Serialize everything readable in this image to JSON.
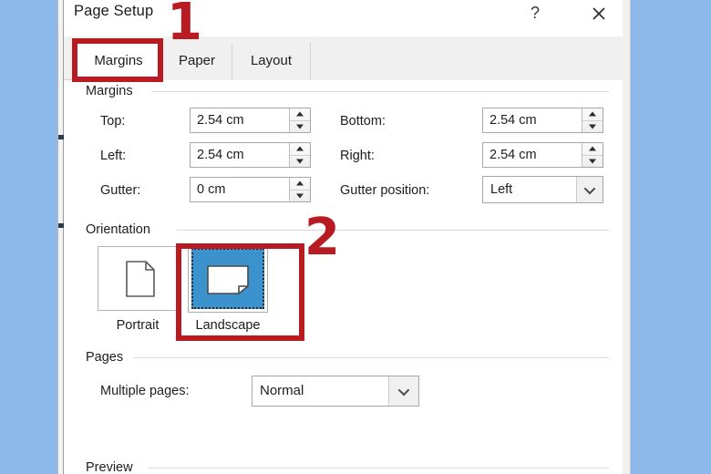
{
  "window": {
    "title": "Page Setup",
    "help_icon": "?",
    "help_icon_name": "help-icon",
    "close_icon_name": "close-icon"
  },
  "tabs": [
    {
      "label": "Margins",
      "active": true
    },
    {
      "label": "Paper",
      "active": false
    },
    {
      "label": "Layout",
      "active": false
    }
  ],
  "groups": {
    "margins": {
      "title": "Margins"
    },
    "orientation": {
      "title": "Orientation"
    },
    "pages": {
      "title": "Pages"
    },
    "preview": {
      "title": "Preview"
    }
  },
  "margins": {
    "top": {
      "label": "Top:",
      "value": "2.54 cm"
    },
    "left": {
      "label": "Left:",
      "value": "2.54 cm"
    },
    "gutter": {
      "label": "Gutter:",
      "value": "0 cm"
    },
    "bottom": {
      "label": "Bottom:",
      "value": "2.54 cm"
    },
    "right": {
      "label": "Right:",
      "value": "2.54 cm"
    },
    "gutter_position": {
      "label": "Gutter position:",
      "value": "Left"
    }
  },
  "orientation": {
    "portrait": {
      "label": "Portrait",
      "selected": false
    },
    "landscape": {
      "label": "Landscape",
      "selected": true
    }
  },
  "pages": {
    "multiple_pages": {
      "label": "Multiple pages:",
      "value": "Normal"
    }
  },
  "annotations": [
    {
      "number": "1",
      "target": "Margins tab"
    },
    {
      "number": "2",
      "target": "Landscape orientation"
    }
  ],
  "colors": {
    "backdrop_blue": "#8cb9ea",
    "annotation_red": "#b81c22",
    "selection_blue": "#3b92cd",
    "tabstrip_gray": "#f0f0f0"
  }
}
